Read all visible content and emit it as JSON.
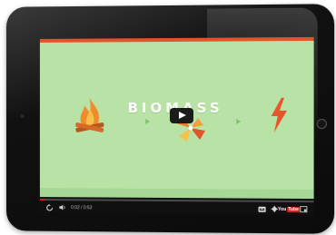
{
  "video": {
    "title": "BIOMASS",
    "progress_fraction": 0.005
  },
  "controls": {
    "current_time": "0:02",
    "separator": " / ",
    "duration": "0:53",
    "youtube_label_you": "You",
    "youtube_label_tube": "Tube"
  },
  "icons": {
    "replay": "replay-icon",
    "volume": "volume-icon",
    "cc": "captions-icon",
    "settings": "gear-icon",
    "fullscreen": "fullscreen-icon",
    "play": "play-icon",
    "fire": "campfire-icon",
    "bolt": "lightning-bolt-icon",
    "turbine": "pinwheel-icon"
  },
  "colors": {
    "video_bg": "#b9e3a6",
    "accent": "#e2552c",
    "progress": "#cc1f1f",
    "controls_bg": "#101010"
  }
}
